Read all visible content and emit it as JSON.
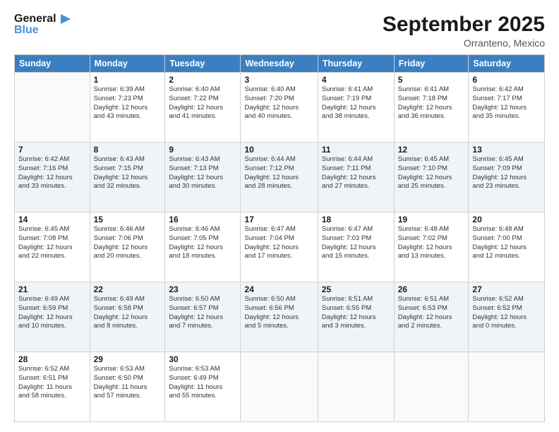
{
  "logo": {
    "text_general": "General",
    "text_blue": "Blue"
  },
  "header": {
    "month": "September 2025",
    "location": "Orranteno, Mexico"
  },
  "days_of_week": [
    "Sunday",
    "Monday",
    "Tuesday",
    "Wednesday",
    "Thursday",
    "Friday",
    "Saturday"
  ],
  "weeks": [
    [
      {
        "day": "",
        "info": ""
      },
      {
        "day": "1",
        "info": "Sunrise: 6:39 AM\nSunset: 7:23 PM\nDaylight: 12 hours\nand 43 minutes."
      },
      {
        "day": "2",
        "info": "Sunrise: 6:40 AM\nSunset: 7:22 PM\nDaylight: 12 hours\nand 41 minutes."
      },
      {
        "day": "3",
        "info": "Sunrise: 6:40 AM\nSunset: 7:20 PM\nDaylight: 12 hours\nand 40 minutes."
      },
      {
        "day": "4",
        "info": "Sunrise: 6:41 AM\nSunset: 7:19 PM\nDaylight: 12 hours\nand 38 minutes."
      },
      {
        "day": "5",
        "info": "Sunrise: 6:41 AM\nSunset: 7:18 PM\nDaylight: 12 hours\nand 36 minutes."
      },
      {
        "day": "6",
        "info": "Sunrise: 6:42 AM\nSunset: 7:17 PM\nDaylight: 12 hours\nand 35 minutes."
      }
    ],
    [
      {
        "day": "7",
        "info": "Sunrise: 6:42 AM\nSunset: 7:16 PM\nDaylight: 12 hours\nand 33 minutes."
      },
      {
        "day": "8",
        "info": "Sunrise: 6:43 AM\nSunset: 7:15 PM\nDaylight: 12 hours\nand 32 minutes."
      },
      {
        "day": "9",
        "info": "Sunrise: 6:43 AM\nSunset: 7:13 PM\nDaylight: 12 hours\nand 30 minutes."
      },
      {
        "day": "10",
        "info": "Sunrise: 6:44 AM\nSunset: 7:12 PM\nDaylight: 12 hours\nand 28 minutes."
      },
      {
        "day": "11",
        "info": "Sunrise: 6:44 AM\nSunset: 7:11 PM\nDaylight: 12 hours\nand 27 minutes."
      },
      {
        "day": "12",
        "info": "Sunrise: 6:45 AM\nSunset: 7:10 PM\nDaylight: 12 hours\nand 25 minutes."
      },
      {
        "day": "13",
        "info": "Sunrise: 6:45 AM\nSunset: 7:09 PM\nDaylight: 12 hours\nand 23 minutes."
      }
    ],
    [
      {
        "day": "14",
        "info": "Sunrise: 6:45 AM\nSunset: 7:08 PM\nDaylight: 12 hours\nand 22 minutes."
      },
      {
        "day": "15",
        "info": "Sunrise: 6:46 AM\nSunset: 7:06 PM\nDaylight: 12 hours\nand 20 minutes."
      },
      {
        "day": "16",
        "info": "Sunrise: 6:46 AM\nSunset: 7:05 PM\nDaylight: 12 hours\nand 18 minutes."
      },
      {
        "day": "17",
        "info": "Sunrise: 6:47 AM\nSunset: 7:04 PM\nDaylight: 12 hours\nand 17 minutes."
      },
      {
        "day": "18",
        "info": "Sunrise: 6:47 AM\nSunset: 7:03 PM\nDaylight: 12 hours\nand 15 minutes."
      },
      {
        "day": "19",
        "info": "Sunrise: 6:48 AM\nSunset: 7:02 PM\nDaylight: 12 hours\nand 13 minutes."
      },
      {
        "day": "20",
        "info": "Sunrise: 6:48 AM\nSunset: 7:00 PM\nDaylight: 12 hours\nand 12 minutes."
      }
    ],
    [
      {
        "day": "21",
        "info": "Sunrise: 6:49 AM\nSunset: 6:59 PM\nDaylight: 12 hours\nand 10 minutes."
      },
      {
        "day": "22",
        "info": "Sunrise: 6:49 AM\nSunset: 6:58 PM\nDaylight: 12 hours\nand 8 minutes."
      },
      {
        "day": "23",
        "info": "Sunrise: 6:50 AM\nSunset: 6:57 PM\nDaylight: 12 hours\nand 7 minutes."
      },
      {
        "day": "24",
        "info": "Sunrise: 6:50 AM\nSunset: 6:56 PM\nDaylight: 12 hours\nand 5 minutes."
      },
      {
        "day": "25",
        "info": "Sunrise: 6:51 AM\nSunset: 6:55 PM\nDaylight: 12 hours\nand 3 minutes."
      },
      {
        "day": "26",
        "info": "Sunrise: 6:51 AM\nSunset: 6:53 PM\nDaylight: 12 hours\nand 2 minutes."
      },
      {
        "day": "27",
        "info": "Sunrise: 6:52 AM\nSunset: 6:52 PM\nDaylight: 12 hours\nand 0 minutes."
      }
    ],
    [
      {
        "day": "28",
        "info": "Sunrise: 6:52 AM\nSunset: 6:51 PM\nDaylight: 11 hours\nand 58 minutes."
      },
      {
        "day": "29",
        "info": "Sunrise: 6:53 AM\nSunset: 6:50 PM\nDaylight: 11 hours\nand 57 minutes."
      },
      {
        "day": "30",
        "info": "Sunrise: 6:53 AM\nSunset: 6:49 PM\nDaylight: 11 hours\nand 55 minutes."
      },
      {
        "day": "",
        "info": ""
      },
      {
        "day": "",
        "info": ""
      },
      {
        "day": "",
        "info": ""
      },
      {
        "day": "",
        "info": ""
      }
    ]
  ]
}
